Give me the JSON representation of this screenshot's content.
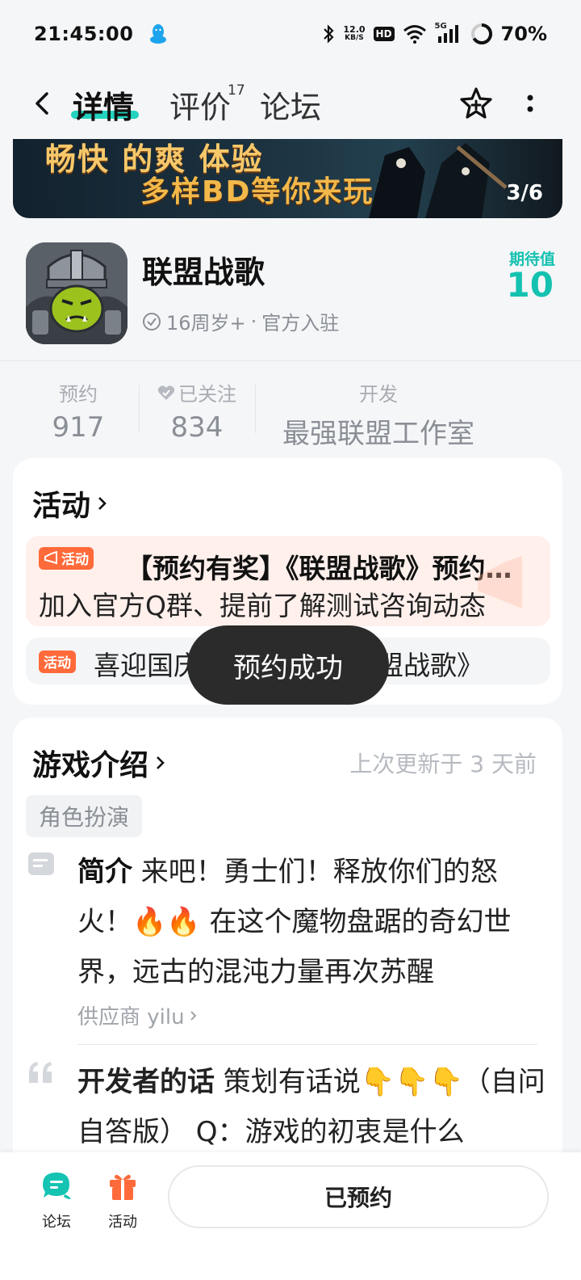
{
  "status_bar": {
    "time": "21:45:00",
    "net_speed_value": "12.0",
    "net_speed_unit": "KB/S",
    "hd": "HD",
    "signal": "5G",
    "battery": "70%"
  },
  "nav": {
    "tabs": [
      {
        "label": "详情"
      },
      {
        "label": "评价",
        "count": "17"
      },
      {
        "label": "论坛"
      }
    ]
  },
  "banner": {
    "line1": "畅快 的爽 体验",
    "line2": "多样BD等你来玩!",
    "index": "3/6"
  },
  "game": {
    "title": "联盟战歌",
    "age": "16周岁+",
    "separator": "·",
    "official": "官方入驻",
    "expect_label": "期待值",
    "expect_value": "10"
  },
  "stats": [
    {
      "label": "预约",
      "value": "917"
    },
    {
      "label": "已关注",
      "value": "834"
    },
    {
      "label": "开发",
      "value": "最强联盟工作室"
    }
  ],
  "activity": {
    "title": "活动",
    "items": [
      {
        "badge": "活动",
        "title": "【预约有奖】《联盟战歌》预约开启",
        "subtitle": "加入官方Q群、提前了解测试咨询动态"
      },
      {
        "badge": "活动",
        "title": "喜迎国庆  预约有礼  《联盟战歌》"
      }
    ]
  },
  "toast": "预约成功",
  "intro": {
    "title": "游戏介绍",
    "updated": "上次更新于 3 天前",
    "tag": "角色扮演",
    "summary_label": "简介",
    "summary_text": " 来吧！勇士们！释放你们的怒火！🔥🔥 在这个魔物盘踞的奇幻世界，远古的混沌力量再次苏醒",
    "supplier": "供应商 yilu",
    "dev_label": "开发者的话",
    "dev_text": " 策划有话说👇👇👇（自问自答版） Q：游戏的初衷是什么"
  },
  "bottom_bar": {
    "forum": "论坛",
    "activity": "活动",
    "reserved": "已预约"
  },
  "colors": {
    "accent": "#15c2b0",
    "activity_badge": "#ff6a3a",
    "toast_bg": "#2b2b2b"
  }
}
